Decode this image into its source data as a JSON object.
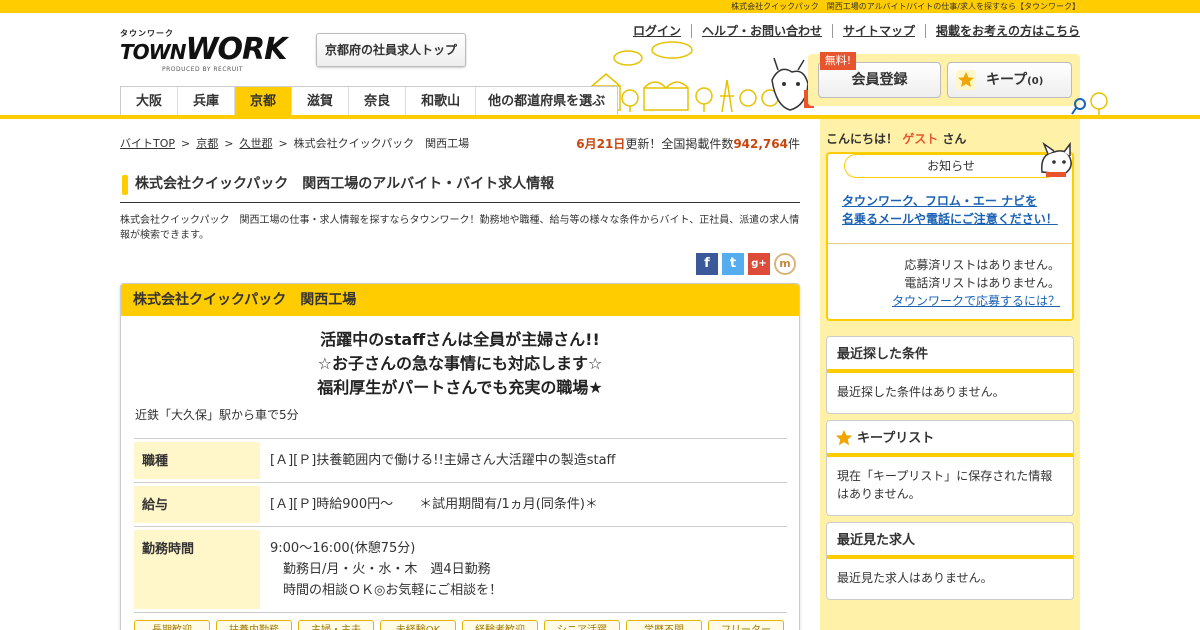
{
  "topbar": {
    "tagline": "株式会社クイックパック　関西工場のアルバイト/バイトの仕事/求人を探すなら【タウンワーク】"
  },
  "logo": {
    "kana": "タウンワーク",
    "word_a": "TOWN",
    "word_b": "WORK",
    "produced": "PRODUCED BY RECRUIT"
  },
  "header": {
    "pref_top_button": "京都府の社員求人トップ",
    "links": [
      "ログイン",
      "ヘルプ・お問い合わせ",
      "サイトマップ",
      "掲載をお考えの方はこちら"
    ],
    "register_label": "会員登録",
    "free_badge": "無料!",
    "keep_label": "キープ",
    "keep_count": "(0)"
  },
  "tabs": [
    {
      "label": "大阪",
      "active": false
    },
    {
      "label": "兵庫",
      "active": false
    },
    {
      "label": "京都",
      "active": true
    },
    {
      "label": "滋賀",
      "active": false
    },
    {
      "label": "奈良",
      "active": false
    },
    {
      "label": "和歌山",
      "active": false
    },
    {
      "label": "他の都道府県を選ぶ",
      "active": false
    }
  ],
  "breadcrumb": {
    "items": [
      "バイトTOP",
      "京都",
      "久世郡"
    ],
    "current": "株式会社クイックパック　関西工場",
    "separator": ">"
  },
  "update": {
    "date": "6月21日",
    "text1": "更新！全国掲載件数",
    "count": "942,764",
    "unit": "件"
  },
  "page": {
    "title": "株式会社クイックパック　関西工場のアルバイト・バイト求人情報",
    "description": "株式会社クイックパック　関西工場の仕事・求人情報を探すならタウンワーク！勤務地や職種、給与等の様々な条件からバイト、正社員、派遣の求人情報が検索できます。"
  },
  "social": {
    "facebook": "f",
    "twitter": "t",
    "googleplus": "g+",
    "mixi": "m"
  },
  "job": {
    "company": "株式会社クイックパック　関西工場",
    "catch_line1": "活躍中のstaffさんは全員が主婦さん!!",
    "catch_line2": "☆お子さんの急な事情にも対応します☆",
    "catch_line3": "福利厚生がパートさんでも充実の職場★",
    "access": "近鉄「大久保」駅から車で5分",
    "rows": [
      {
        "label": "職種",
        "value": "[Ａ][Ｐ]扶養範囲内で働ける!!主婦さん大活躍中の製造staff"
      },
      {
        "label": "給与",
        "value": "[Ａ][Ｐ]時給900円～　　＊試用期間有/1ヵ月(同条件)＊"
      },
      {
        "label": "勤務時間",
        "value": "9:00～16:00(休憩75分)\n　勤務日/月・火・水・木　週4日勤務\n　時間の相談ＯＫ◎お気軽にご相談を！"
      }
    ],
    "tags": [
      "長期歓迎",
      "扶養内勤務",
      "主婦・主夫",
      "未経験OK",
      "経験者歓迎",
      "シニア活躍",
      "学歴不問",
      "フリーター"
    ]
  },
  "sidebar": {
    "greeting_prefix": "こんにちは！",
    "guest": "ゲスト",
    "greeting_suffix": "さん",
    "notice": {
      "title": "お知らせ",
      "warning_line1": "タウンワーク、フロム・エー ナビを",
      "warning_line2": "名乗るメールや電話にご注意ください！",
      "applied_list": "応募済リストはありません。",
      "phone_list": "電話済リストはありません。",
      "how_to_apply": "タウンワークで応募するには？"
    },
    "recent_conditions": {
      "title": "最近探した条件",
      "body": "最近探した条件はありません。"
    },
    "keep_list": {
      "title": "キープリスト",
      "body": "現在「キープリスト」に保存された情報はありません。"
    },
    "recent_jobs": {
      "title": "最近見た求人",
      "body": "最近見た求人はありません。"
    }
  },
  "colors": {
    "brand_yellow": "#ffcc00",
    "sidebar_bg": "#fff2a8",
    "accent_orange": "#e8542d",
    "link_blue": "#1a62b5"
  }
}
